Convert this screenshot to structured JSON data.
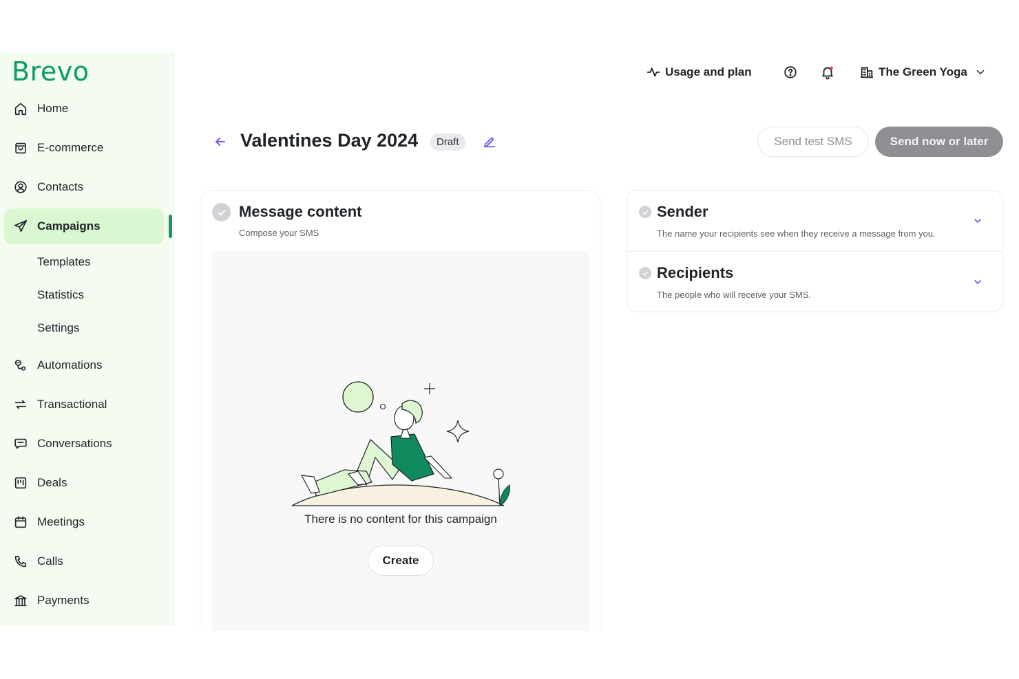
{
  "brand": {
    "name": "Brevo",
    "color": "#0b9d61"
  },
  "sidebar": {
    "items": [
      {
        "label": "Home",
        "icon": "home-icon"
      },
      {
        "label": "E-commerce",
        "icon": "shopping-bag-icon"
      },
      {
        "label": "Contacts",
        "icon": "contact-icon"
      },
      {
        "label": "Campaigns",
        "icon": "send-icon",
        "active": true
      },
      {
        "label": "Automations",
        "icon": "automation-icon"
      },
      {
        "label": "Transactional",
        "icon": "repeat-icon"
      },
      {
        "label": "Conversations",
        "icon": "chat-icon"
      },
      {
        "label": "Deals",
        "icon": "kanban-icon"
      },
      {
        "label": "Meetings",
        "icon": "calendar-icon"
      },
      {
        "label": "Calls",
        "icon": "phone-icon"
      },
      {
        "label": "Payments",
        "icon": "bank-icon"
      }
    ],
    "sub_items": [
      "Templates",
      "Statistics",
      "Settings"
    ]
  },
  "topbar": {
    "usage_label": "Usage and plan",
    "account_name": "The Green Yoga"
  },
  "header": {
    "title": "Valentines Day 2024",
    "status_badge": "Draft",
    "send_test_label": "Send test SMS",
    "send_now_label": "Send now or later"
  },
  "message_card": {
    "title": "Message content",
    "subtitle": "Compose your SMS",
    "empty_text": "There is no content for this campaign",
    "create_label": "Create"
  },
  "sender_card": {
    "title": "Sender",
    "subtitle": "The name your recipients see when they receive a message from you."
  },
  "recipients_card": {
    "title": "Recipients",
    "subtitle": "The people who will receive your SMS."
  },
  "colors": {
    "sidebar_bg": "#f4fcf2",
    "active_bg": "#d9f8d1",
    "accent_purple": "#6b5cf6",
    "notification_dot": "#e5484d",
    "illustration_green": "#0f8a5c"
  }
}
